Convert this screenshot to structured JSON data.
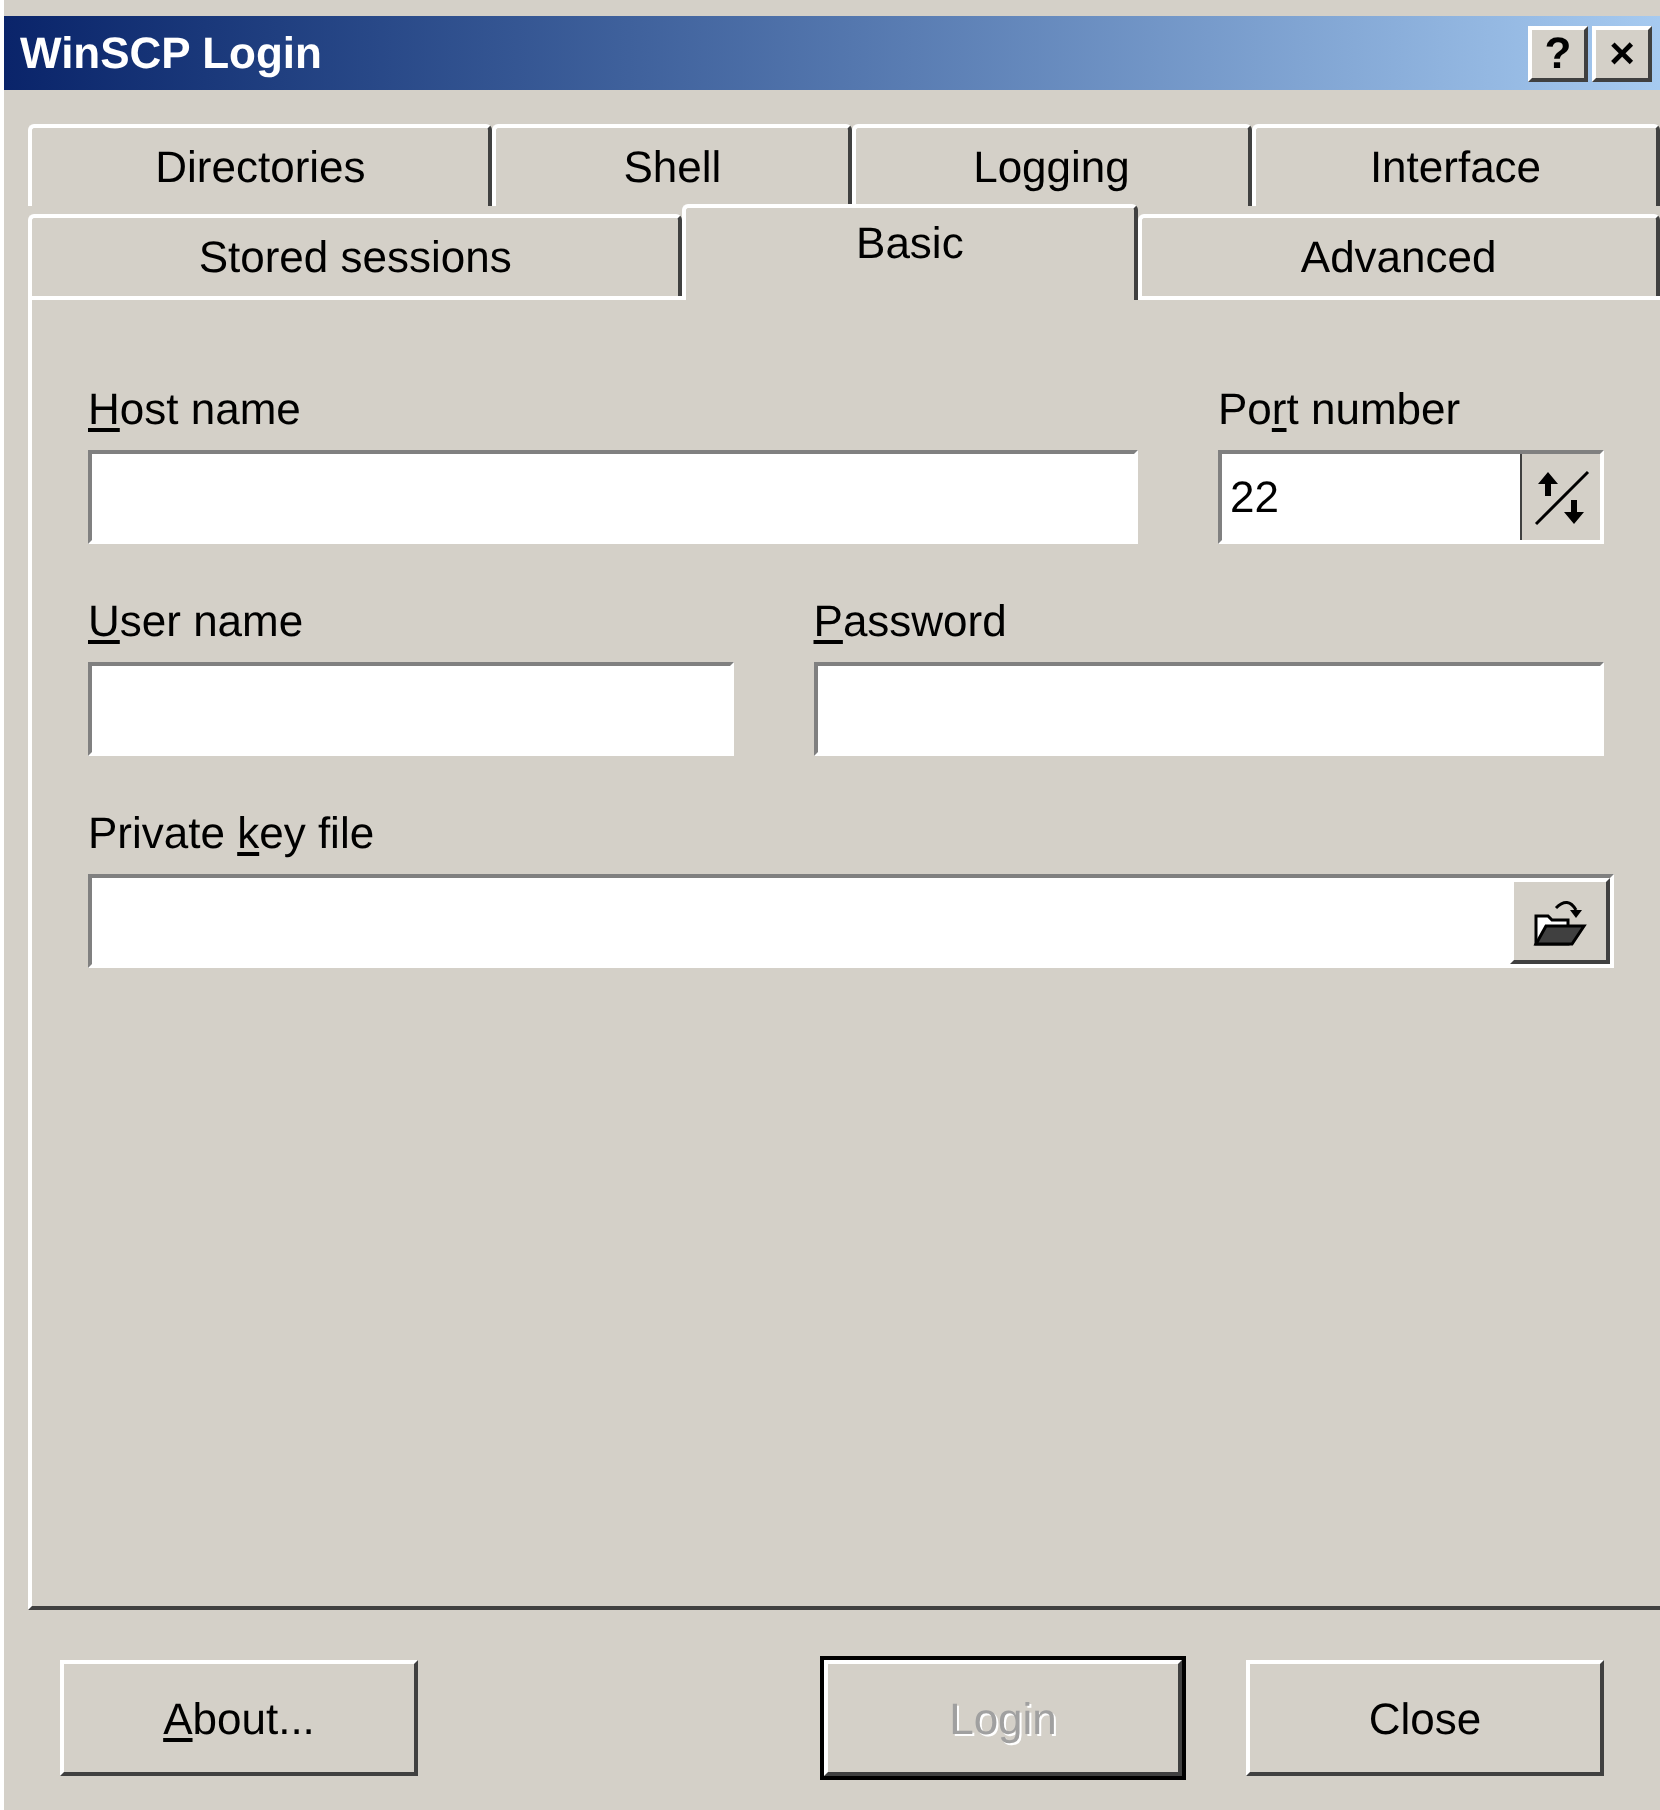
{
  "window": {
    "title": "WinSCP Login",
    "title_buttons": [
      "?",
      "×"
    ]
  },
  "tab_rows": [
    [
      {
        "label": "Directories",
        "selected": false
      },
      {
        "label": "Shell",
        "selected": false
      },
      {
        "label": "Logging",
        "selected": false
      },
      {
        "label": "Interface",
        "selected": false
      }
    ],
    [
      {
        "label": "Stored sessions",
        "selected": false
      },
      {
        "label": "Basic",
        "selected": true
      },
      {
        "label": "Advanced",
        "selected": false
      }
    ]
  ],
  "host": {
    "label": {
      "key": "H",
      "after": "ost name"
    }
  },
  "port": {
    "label": {
      "before": "Po",
      "key": "r",
      "after": "t number"
    },
    "value": "22"
  },
  "user": {
    "label": {
      "key": "U",
      "after": "ser name"
    }
  },
  "password": {
    "label": {
      "key": "P",
      "after": "assword"
    }
  },
  "key_file": {
    "label": {
      "before": "Private ",
      "key": "k",
      "after": "ey file"
    }
  },
  "buttons": [
    {
      "label": {
        "key": "A",
        "after": "bout..."
      },
      "disabled": false,
      "default": false
    },
    {
      "label": {
        "before": "Login"
      },
      "disabled": true,
      "default": true
    },
    {
      "label": {
        "before": "Close"
      },
      "disabled": false,
      "default": false
    }
  ]
}
